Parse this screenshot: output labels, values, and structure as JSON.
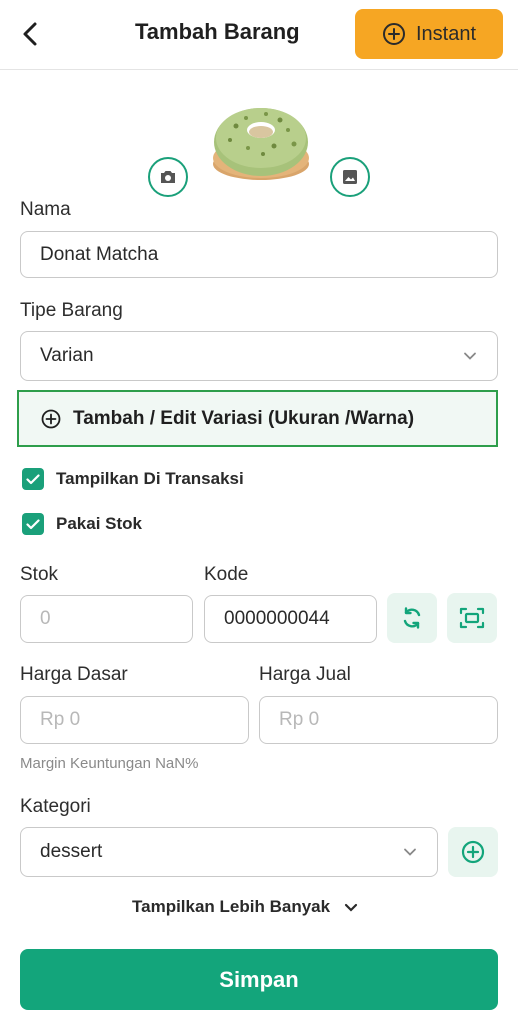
{
  "header": {
    "title": "Tambah Barang",
    "instant_label": "Instant",
    "accent_color": "#f6a623"
  },
  "photo": {
    "description_icon": "donut-photo"
  },
  "form": {
    "name_label": "Nama",
    "name_value": "Donat Matcha",
    "type_label": "Tipe Barang",
    "type_value": "Varian",
    "variant_button_label": "Tambah / Edit Variasi (Ukuran /Warna)",
    "show_in_transactions_label": "Tampilkan Di Transaksi",
    "show_in_transactions_checked": true,
    "use_stock_label": "Pakai Stok",
    "use_stock_checked": true,
    "stock_label": "Stok",
    "stock_placeholder": "0",
    "code_label": "Kode",
    "code_value": "0000000044",
    "base_price_label": "Harga Dasar",
    "base_price_placeholder": "Rp 0",
    "sell_price_label": "Harga Jual",
    "sell_price_placeholder": "Rp 0",
    "margin_hint": "Margin Keuntungan NaN%",
    "category_label": "Kategori",
    "category_value": "dessert",
    "show_more_label": "Tampilkan Lebih Banyak",
    "save_label": "Simpan"
  },
  "colors": {
    "primary": "#13a57b",
    "variant_border": "#2e9e4b"
  }
}
